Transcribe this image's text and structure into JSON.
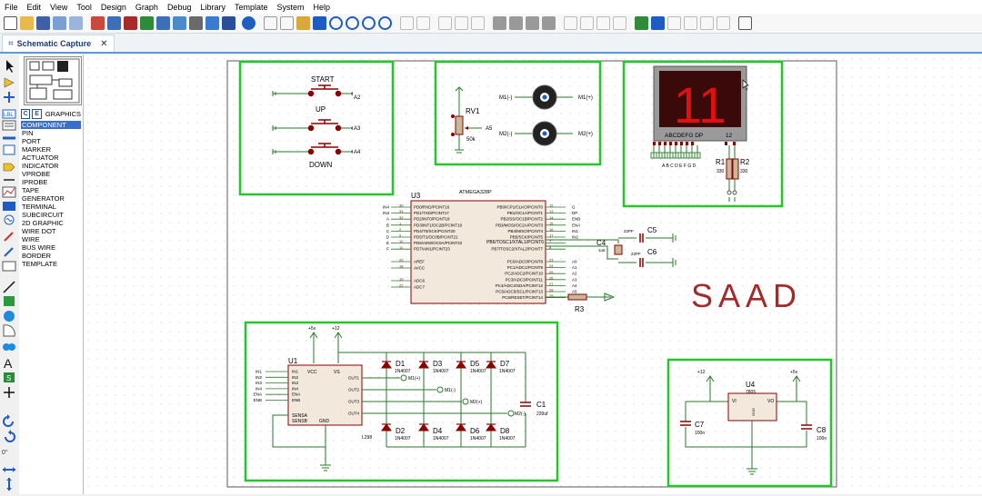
{
  "menu": [
    "File",
    "Edit",
    "View",
    "Tool",
    "Design",
    "Graph",
    "Debug",
    "Library",
    "Template",
    "System",
    "Help"
  ],
  "tab": {
    "title": "Schematic Capture"
  },
  "sidebar": {
    "mode_label": "GRAPHICS",
    "modes": [
      "COMPONENT",
      "PIN",
      "PORT",
      "MARKER",
      "ACTUATOR",
      "INDICATOR",
      "VPROBE",
      "IPROBE",
      "TAPE",
      "GENERATOR",
      "TERMINAL",
      "SUBCIRCUIT",
      "2D GRAPHIC",
      "WIRE DOT",
      "WIRE",
      "BUS WIRE",
      "BORDER",
      "TEMPLATE"
    ],
    "rotation": "0°"
  },
  "schematic": {
    "buttons": {
      "start": "START",
      "up": "UP",
      "down": "DOWN",
      "a2": "A2",
      "a3": "A3",
      "a4": "A4"
    },
    "pot": {
      "ref": "RV1",
      "value": "50k",
      "pin": "A5"
    },
    "motors": {
      "m1n": "M1(-)",
      "m1p": "M1(+)",
      "m2n": "M2(-)",
      "m2p": "M2(+)"
    },
    "display": {
      "digits": "11",
      "pins": "ABCDEFG DP",
      "pins2": "12",
      "r1": "R1",
      "r2": "R2",
      "r1v": "330",
      "r2v": "330",
      "pinrow": "A B C D E F G D"
    },
    "mcu": {
      "ref": "U3",
      "part": "ATMEGA328P",
      "left_pins": [
        "PD0/RXD/PCINT16",
        "PD1/TXD/PCINT17",
        "PD2/INT0/PCINT18",
        "PD3/INT1/OC2B/PCINT19",
        "PD4/T0/XCK/PCINT20",
        "PD5/T1/OC0B/PCINT21",
        "PD6/AIN0/OC0A/PCINT22",
        "PD7/AIN1/PCINT23"
      ],
      "left_nets": [
        "IN4",
        "IN3",
        "A",
        "B",
        "C",
        "D",
        "E",
        "F"
      ],
      "left_nums": [
        "30",
        "31",
        "32",
        "1",
        "2",
        "9",
        "10",
        "11"
      ],
      "power_pins": [
        "AREF",
        "AVCC",
        "ADC6",
        "ADC7"
      ],
      "power_nums": [
        "20",
        "18",
        "19",
        "22"
      ],
      "right_pins": [
        "PB0/ICP1/CLKO/PCINT0",
        "PB1/OC1A/PCINT1",
        "PB2/SS/OC1B/PCINT2",
        "PB3/MOSI/OC2A/PCINT3",
        "PB4/MISO/PCINT4",
        "PB5/SCK/PCINT5",
        "PB6/TOSC1/XTAL1/PCINT6",
        "PB7/TOSC2/XTAL2/PCINT7"
      ],
      "right_nets": [
        "G",
        "DP",
        "ENB",
        "ENA",
        "IN1",
        "IN2"
      ],
      "right_nums": [
        "12",
        "13",
        "14",
        "15",
        "16",
        "17",
        "7",
        "8"
      ],
      "adc_pins": [
        "PC0/ADC0/PCINT8",
        "PC1/ADC1/PCINT9",
        "PC2/ADC2/PCINT10",
        "PC3/ADC3/PCINT11",
        "PC4/ADC4/SDA/PCINT12",
        "PC5/ADC5/SCL/PCINT13",
        "PC6/RESET/PCINT14"
      ],
      "adc_nets": [
        "A0",
        "A1",
        "A2",
        "A3",
        "A4",
        "A5"
      ],
      "adc_nums": [
        "23",
        "24",
        "25",
        "26",
        "27",
        "28",
        "29"
      ]
    },
    "crystal": {
      "c4": "C4",
      "c5": "C5",
      "c6": "C6",
      "c4v": "1u5",
      "c5v": "22PF",
      "c6v": "22PF"
    },
    "r3": "R3",
    "title_text": "SAAD",
    "driver": {
      "ref": "U1",
      "part": "L298",
      "vcc": "VCC",
      "vs": "VS",
      "gnd": "GND",
      "inputs": [
        "IN1",
        "IN2",
        "IN3",
        "IN4",
        "ENA",
        "ENB"
      ],
      "in_labels": [
        "IN1",
        "IN2",
        "IN3",
        "IN4",
        "ENA",
        "ENB"
      ],
      "sense": [
        "SENSA",
        "SENSB"
      ],
      "outputs": [
        "OUT1",
        "OUT2",
        "OUT3",
        "OUT4"
      ],
      "rails": [
        "+5v",
        "+12"
      ],
      "diodes": [
        "D1",
        "D3",
        "D5",
        "D7",
        "D2",
        "D4",
        "D6",
        "D8"
      ],
      "diode_value": "1N4007",
      "motor_labels": [
        "M1(+)",
        "M1(-)",
        "M2(+)",
        "M2(-)"
      ],
      "cap": "C1",
      "cap_value": "220uf"
    },
    "regulator": {
      "ref": "U4",
      "part": "7805",
      "vi": "VI",
      "vo": "VO",
      "gnd": "GND",
      "in_rail": "+12",
      "out_rail": "+5v",
      "c7": "C7",
      "c8": "C8",
      "c7v": "100n",
      "c8v": "100n"
    }
  },
  "colors": {
    "highlight_box": "#22c72a",
    "wire": "#2a7a2a",
    "component": "#8b0000",
    "title": "#a52a2a",
    "selected": "#3a6fc8"
  }
}
